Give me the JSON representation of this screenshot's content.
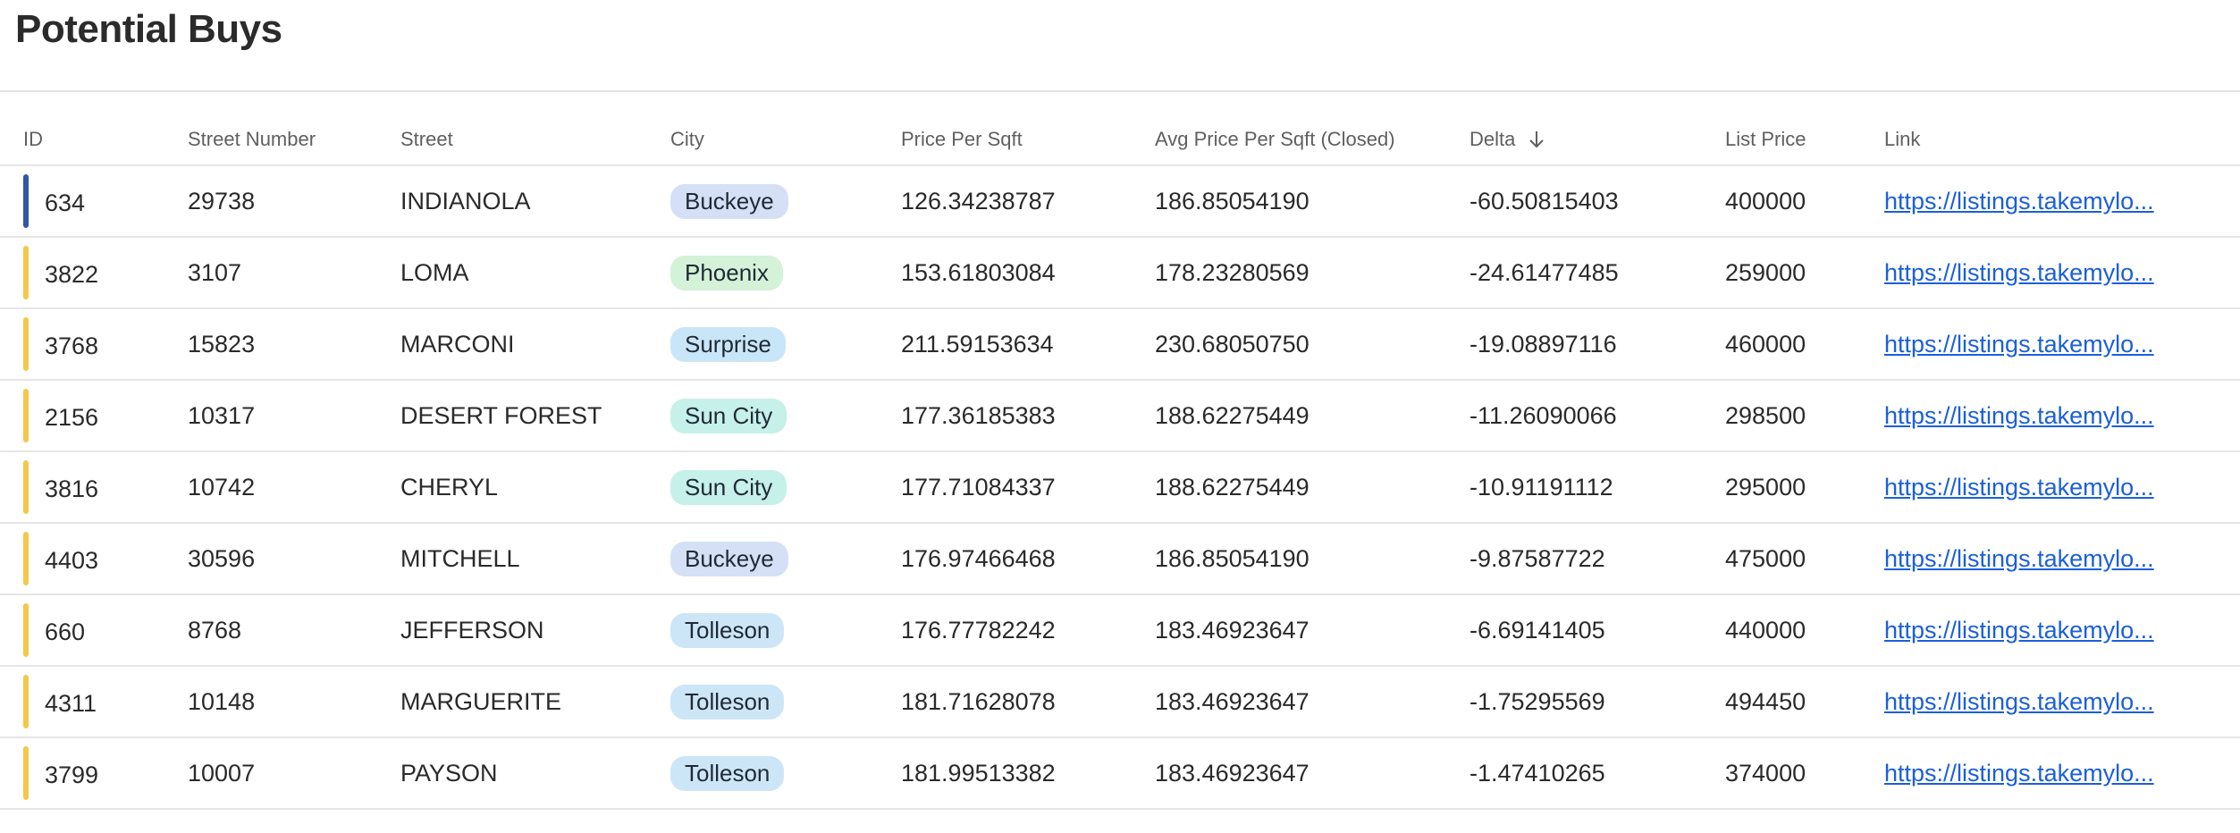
{
  "page": {
    "title": "Potential Buys"
  },
  "columns": {
    "id": "ID",
    "street_number": "Street Number",
    "street": "Street",
    "city": "City",
    "price_per_sqft": "Price Per Sqft",
    "avg_price_per_sqft": "Avg Price Per Sqft (Closed)",
    "delta": "Delta",
    "list_price": "List Price",
    "link": "Link"
  },
  "sort": {
    "column": "Delta",
    "direction": "descending-arrow",
    "icon": "arrow-down-icon"
  },
  "city_colors": {
    "Buckeye": "#d5e0f7",
    "Phoenix": "#d3f2d8",
    "Surprise": "#c9e6f8",
    "Sun City": "#c6f0ea",
    "Tolleson": "#cde6f7"
  },
  "status_colors": {
    "blue": "#2f55a8",
    "yellow": "#f4c84a"
  },
  "rows": [
    {
      "id": "634",
      "status": "blue",
      "street_number": "29738",
      "street": "INDIANOLA",
      "city": "Buckeye",
      "price_per_sqft": "126.34238787",
      "avg_price_per_sqft": "186.85054190",
      "delta": "-60.50815403",
      "list_price": "400000",
      "link": "https://listings.takemylo..."
    },
    {
      "id": "3822",
      "status": "yellow",
      "street_number": "3107",
      "street": "LOMA",
      "city": "Phoenix",
      "price_per_sqft": "153.61803084",
      "avg_price_per_sqft": "178.23280569",
      "delta": "-24.61477485",
      "list_price": "259000",
      "link": "https://listings.takemylo..."
    },
    {
      "id": "3768",
      "status": "yellow",
      "street_number": "15823",
      "street": "MARCONI",
      "city": "Surprise",
      "price_per_sqft": "211.59153634",
      "avg_price_per_sqft": "230.68050750",
      "delta": "-19.08897116",
      "list_price": "460000",
      "link": "https://listings.takemylo..."
    },
    {
      "id": "2156",
      "status": "yellow",
      "street_number": "10317",
      "street": "DESERT FOREST",
      "city": "Sun City",
      "price_per_sqft": "177.36185383",
      "avg_price_per_sqft": "188.62275449",
      "delta": "-11.26090066",
      "list_price": "298500",
      "link": "https://listings.takemylo..."
    },
    {
      "id": "3816",
      "status": "yellow",
      "street_number": "10742",
      "street": "CHERYL",
      "city": "Sun City",
      "price_per_sqft": "177.71084337",
      "avg_price_per_sqft": "188.62275449",
      "delta": "-10.91191112",
      "list_price": "295000",
      "link": "https://listings.takemylo..."
    },
    {
      "id": "4403",
      "status": "yellow",
      "street_number": "30596",
      "street": "MITCHELL",
      "city": "Buckeye",
      "price_per_sqft": "176.97466468",
      "avg_price_per_sqft": "186.85054190",
      "delta": "-9.87587722",
      "list_price": "475000",
      "link": "https://listings.takemylo..."
    },
    {
      "id": "660",
      "status": "yellow",
      "street_number": "8768",
      "street": "JEFFERSON",
      "city": "Tolleson",
      "price_per_sqft": "176.77782242",
      "avg_price_per_sqft": "183.46923647",
      "delta": "-6.69141405",
      "list_price": "440000",
      "link": "https://listings.takemylo..."
    },
    {
      "id": "4311",
      "status": "yellow",
      "street_number": "10148",
      "street": "MARGUERITE",
      "city": "Tolleson",
      "price_per_sqft": "181.71628078",
      "avg_price_per_sqft": "183.46923647",
      "delta": "-1.75295569",
      "list_price": "494450",
      "link": "https://listings.takemylo..."
    },
    {
      "id": "3799",
      "status": "yellow",
      "street_number": "10007",
      "street": "PAYSON",
      "city": "Tolleson",
      "price_per_sqft": "181.99513382",
      "avg_price_per_sqft": "183.46923647",
      "delta": "-1.47410265",
      "list_price": "374000",
      "link": "https://listings.takemylo..."
    }
  ]
}
